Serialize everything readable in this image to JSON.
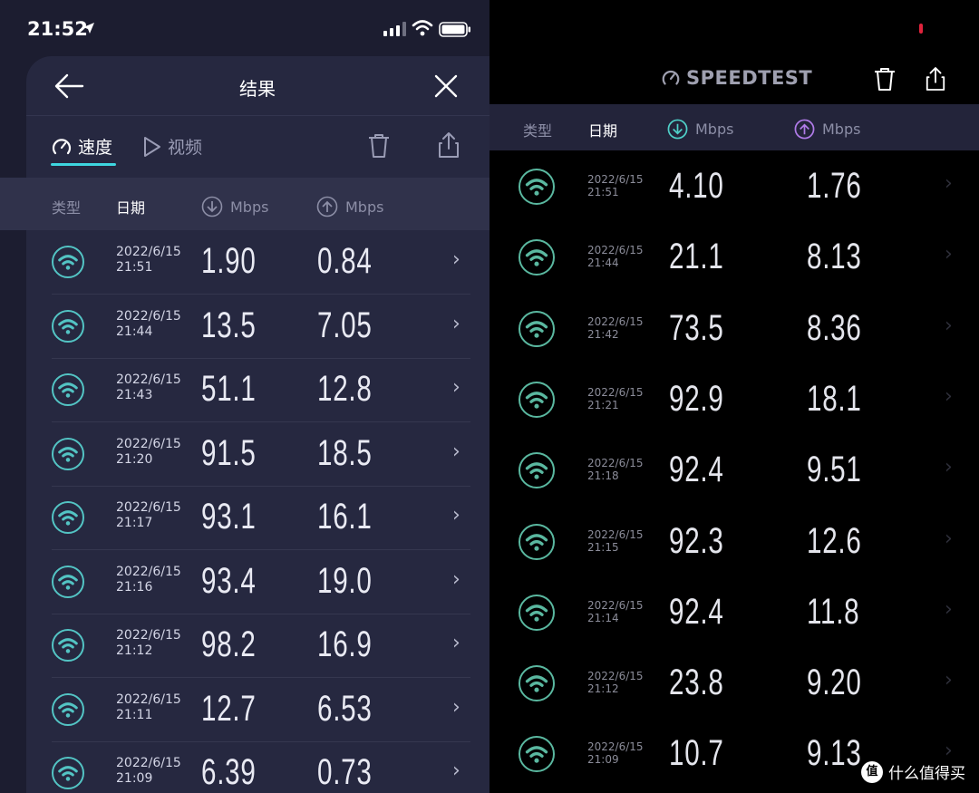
{
  "left": {
    "status_bar": {
      "time": "21:52"
    },
    "header": {
      "title": "结果"
    },
    "tabs": [
      {
        "label": "速度"
      },
      {
        "label": "视频"
      }
    ],
    "columns": {
      "type": "类型",
      "date": "日期",
      "download_unit": "Mbps",
      "upload_unit": "Mbps"
    },
    "rows": [
      {
        "date": "2022/6/15",
        "time": "21:51",
        "download": "1.90",
        "upload": "0.84"
      },
      {
        "date": "2022/6/15",
        "time": "21:44",
        "download": "13.5",
        "upload": "7.05"
      },
      {
        "date": "2022/6/15",
        "time": "21:43",
        "download": "51.1",
        "upload": "12.8"
      },
      {
        "date": "2022/6/15",
        "time": "21:20",
        "download": "91.5",
        "upload": "18.5"
      },
      {
        "date": "2022/6/15",
        "time": "21:17",
        "download": "93.1",
        "upload": "16.1"
      },
      {
        "date": "2022/6/15",
        "time": "21:16",
        "download": "93.4",
        "upload": "19.0"
      },
      {
        "date": "2022/6/15",
        "time": "21:12",
        "download": "98.2",
        "upload": "16.9"
      },
      {
        "date": "2022/6/15",
        "time": "21:11",
        "download": "12.7",
        "upload": "6.53"
      },
      {
        "date": "2022/6/15",
        "time": "21:09",
        "download": "6.39",
        "upload": "0.73"
      }
    ]
  },
  "right": {
    "brand": "SPEEDTEST",
    "columns": {
      "type": "类型",
      "date": "日期",
      "download_unit": "Mbps",
      "upload_unit": "Mbps"
    },
    "rows": [
      {
        "date": "2022/6/15",
        "time": "21:51",
        "download": "4.10",
        "upload": "1.76"
      },
      {
        "date": "2022/6/15",
        "time": "21:44",
        "download": "21.1",
        "upload": "8.13"
      },
      {
        "date": "2022/6/15",
        "time": "21:42",
        "download": "73.5",
        "upload": "8.36"
      },
      {
        "date": "2022/6/15",
        "time": "21:21",
        "download": "92.9",
        "upload": "18.1"
      },
      {
        "date": "2022/6/15",
        "time": "21:18",
        "download": "92.4",
        "upload": "9.51"
      },
      {
        "date": "2022/6/15",
        "time": "21:15",
        "download": "92.3",
        "upload": "12.6"
      },
      {
        "date": "2022/6/15",
        "time": "21:14",
        "download": "92.4",
        "upload": "11.8"
      },
      {
        "date": "2022/6/15",
        "time": "21:12",
        "download": "23.8",
        "upload": "9.20"
      },
      {
        "date": "2022/6/15",
        "time": "21:09",
        "download": "10.7",
        "upload": "9.13"
      }
    ]
  },
  "watermark": {
    "badge": "值",
    "text": "什么值得买"
  },
  "colors": {
    "accent_teal": "#3ed6e0",
    "download_icon": "#4fd0c8",
    "upload_icon": "#b07be8",
    "wifi_icon": "#53c4c4"
  },
  "icons": [
    "location-arrow-icon",
    "cellular-signal-icon",
    "wifi-status-icon",
    "battery-icon",
    "back-arrow-icon",
    "close-icon",
    "speed-gauge-icon",
    "play-icon",
    "trash-icon",
    "share-icon",
    "download-arrow-icon",
    "upload-arrow-icon",
    "wifi-icon",
    "chevron-right-icon"
  ]
}
